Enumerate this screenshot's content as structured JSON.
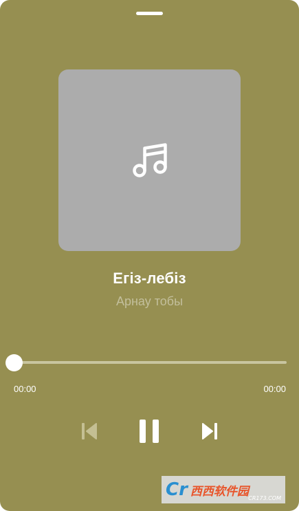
{
  "player": {
    "track_title": "Егіз-лебіз",
    "artist": "Арнау тобы",
    "elapsed": "00:00",
    "duration": "00:00",
    "progress": 0
  },
  "icons": {
    "artwork": "music-note-icon",
    "previous": "skip-previous-icon",
    "play_pause": "pause-icon",
    "next": "skip-next-icon"
  },
  "watermark": {
    "logo": "Cr",
    "text": "西西软件园",
    "sub": "CR173.COM"
  },
  "colors": {
    "background": "#968f51",
    "artwork_placeholder": "#acacac",
    "artist_text": "#c3bf9c",
    "track": "#c8c59f"
  }
}
